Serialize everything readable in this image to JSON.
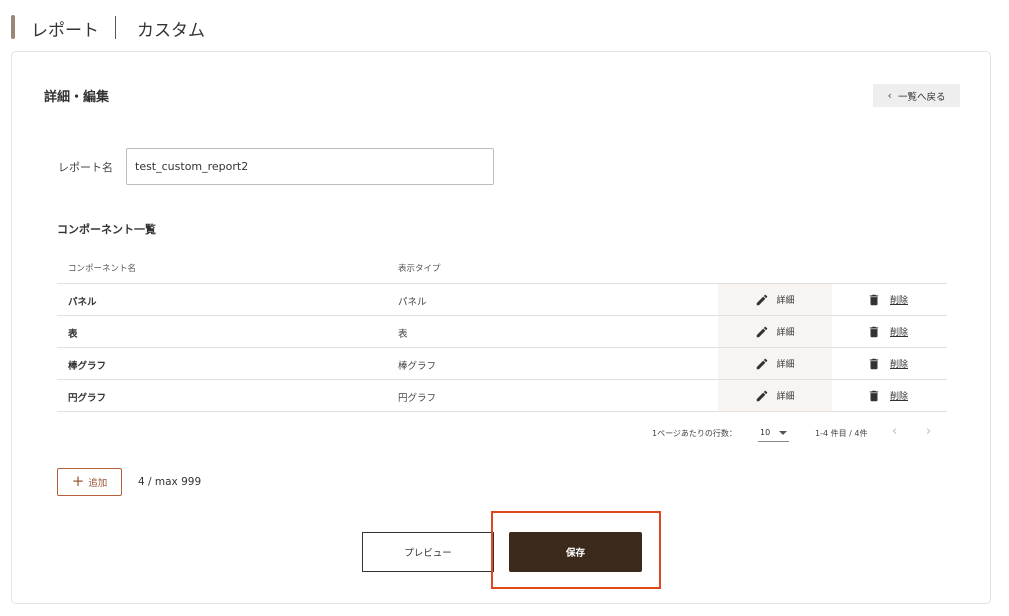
{
  "header": {
    "title": "レポート",
    "subtitle": "カスタム"
  },
  "section": {
    "title": "詳細・編集",
    "back_label": "一覧へ戻る"
  },
  "form": {
    "name_label": "レポート名",
    "name_value": "test_custom_report2"
  },
  "components": {
    "title": "コンポーネント一覧",
    "columns": {
      "name": "コンポーネント名",
      "type": "表示タイプ"
    },
    "detail_label": "詳細",
    "delete_label": "削除",
    "rows": [
      {
        "name": "パネル",
        "type": "パネル"
      },
      {
        "name": "表",
        "type": "表"
      },
      {
        "name": "棒グラフ",
        "type": "棒グラフ"
      },
      {
        "name": "円グラフ",
        "type": "円グラフ"
      }
    ]
  },
  "pagination": {
    "rows_per_page_label": "1ページあたりの行数：",
    "rows_per_page_value": "10",
    "range_text": "1-4 件目 / 4件"
  },
  "actions": {
    "add_label": "追加",
    "count_text": "4 / max 999",
    "preview_label": "プレビュー",
    "save_label": "保存"
  },
  "colors": {
    "accent": "#3b2a1b",
    "add_border": "#b5603a",
    "highlight": "#e04a1a"
  },
  "icons": {
    "back": "chevron-left-icon",
    "detail": "pencil-icon",
    "delete": "trash-icon",
    "add": "plus-icon",
    "select": "caret-down-icon"
  }
}
